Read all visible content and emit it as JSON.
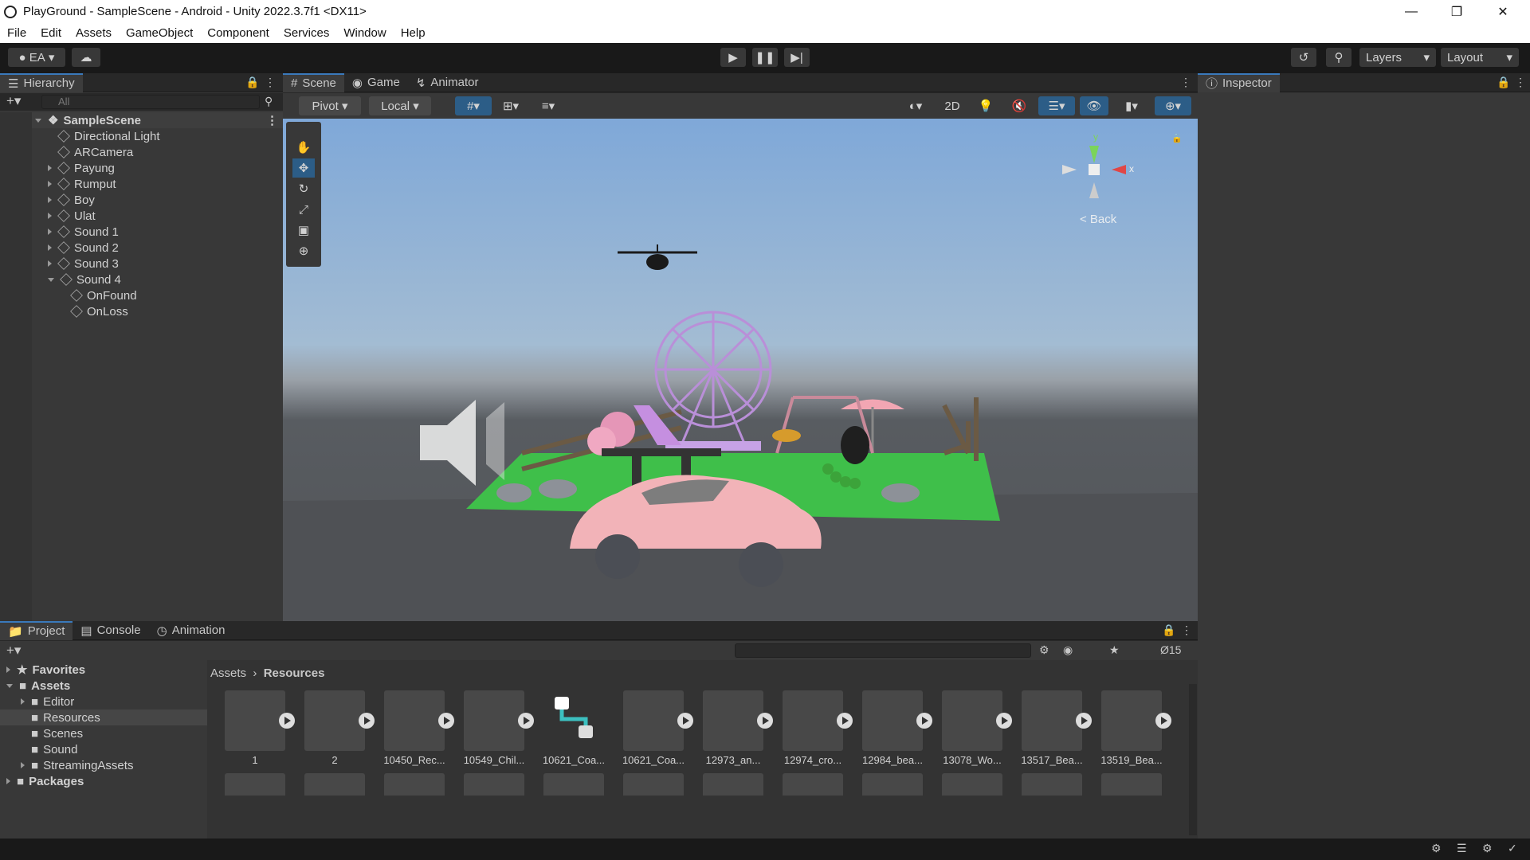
{
  "window": {
    "title": "PlayGround - SampleScene - Android - Unity 2022.3.7f1 <DX11>"
  },
  "menu": [
    "File",
    "Edit",
    "Assets",
    "GameObject",
    "Component",
    "Services",
    "Window",
    "Help"
  ],
  "toolbar": {
    "account": "EA",
    "layers": "Layers",
    "layout": "Layout"
  },
  "hierarchy": {
    "tab": "Hierarchy",
    "search_placeholder": "All",
    "scene": "SampleScene",
    "items": [
      {
        "label": "Directional Light",
        "indent": 1,
        "arrow": "none"
      },
      {
        "label": "ARCamera",
        "indent": 1,
        "arrow": "none"
      },
      {
        "label": "Payung",
        "indent": 1,
        "arrow": "right"
      },
      {
        "label": "Rumput",
        "indent": 1,
        "arrow": "right"
      },
      {
        "label": "Boy",
        "indent": 1,
        "arrow": "right"
      },
      {
        "label": "Ulat",
        "indent": 1,
        "arrow": "right"
      },
      {
        "label": "Sound 1",
        "indent": 1,
        "arrow": "right"
      },
      {
        "label": "Sound 2",
        "indent": 1,
        "arrow": "right"
      },
      {
        "label": "Sound 3",
        "indent": 1,
        "arrow": "right"
      },
      {
        "label": "Sound 4",
        "indent": 1,
        "arrow": "down"
      },
      {
        "label": "OnFound",
        "indent": 2,
        "arrow": "none"
      },
      {
        "label": "OnLoss",
        "indent": 2,
        "arrow": "none"
      }
    ]
  },
  "scene": {
    "tabs": [
      "Scene",
      "Game",
      "Animator"
    ],
    "pivot": "Pivot",
    "local": "Local",
    "mode2d": "2D",
    "gizmo_back": "< Back",
    "gizmo_y": "y",
    "gizmo_x": "x"
  },
  "inspector": {
    "tab": "Inspector"
  },
  "project": {
    "tabs": [
      "Project",
      "Console",
      "Animation"
    ],
    "hidden_count": "15",
    "breadcrumb_root": "Assets",
    "breadcrumb_current": "Resources",
    "tree": [
      {
        "label": "Favorites",
        "indent": 0,
        "arrow": "right",
        "bold": true
      },
      {
        "label": "Assets",
        "indent": 0,
        "arrow": "down",
        "bold": true
      },
      {
        "label": "Editor",
        "indent": 1,
        "arrow": "right"
      },
      {
        "label": "Resources",
        "indent": 1,
        "arrow": "none",
        "selected": true
      },
      {
        "label": "Scenes",
        "indent": 1,
        "arrow": "none"
      },
      {
        "label": "Sound",
        "indent": 1,
        "arrow": "none"
      },
      {
        "label": "StreamingAssets",
        "indent": 1,
        "arrow": "right"
      },
      {
        "label": "Packages",
        "indent": 0,
        "arrow": "right",
        "bold": true
      }
    ],
    "assets": [
      "1",
      "2",
      "10450_Rec...",
      "10549_Chil...",
      "10621_Coa...",
      "10621_Coa...",
      "12973_an...",
      "12974_cro...",
      "12984_bea...",
      "13078_Wo...",
      "13517_Bea...",
      "13519_Bea..."
    ]
  }
}
